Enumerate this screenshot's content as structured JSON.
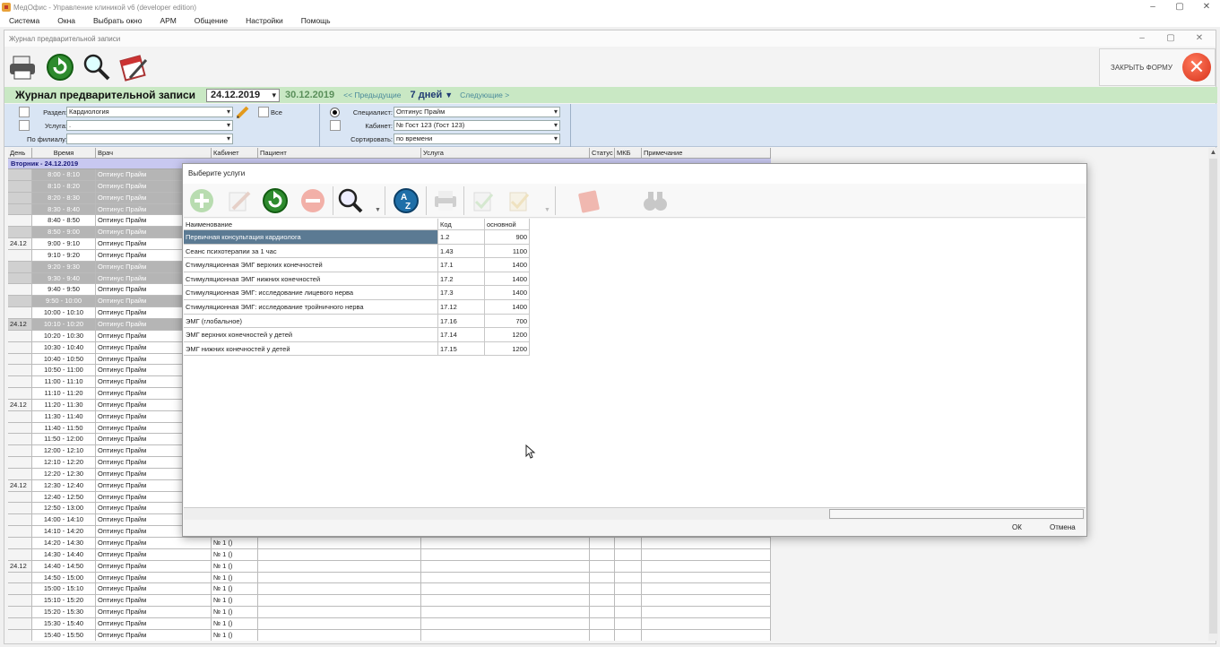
{
  "app": {
    "title": "МедОфис - Управление клиникой v6 (developer edition)"
  },
  "menu": [
    "Система",
    "Окна",
    "Выбрать окно",
    "АРМ",
    "Общение",
    "Настройки",
    "Помощь"
  ],
  "child_window": {
    "title": "Журнал предварительной записи"
  },
  "toolbar": {
    "close_form_label": "ЗАКРЫТЬ ФОРМУ"
  },
  "journal": {
    "title": "Журнал предварительной записи",
    "date_from": "24.12.2019",
    "date_to": "30.12.2019",
    "prev": "<< Предыдущие",
    "days": "7 дней",
    "next": "Следующие >"
  },
  "filters": {
    "section_label": "Раздел:",
    "section_value": "Кардиология",
    "service_label": "Услуга:",
    "service_value": ".",
    "branch_label": "По филиалу:",
    "branch_value": "",
    "all_label": "Все",
    "specialist_label": "Специалист:",
    "specialist_value": "Оптинус Прайм",
    "cabinet_label": "Кабинет:",
    "cabinet_value": "№ Гост 123 (Гост 123)",
    "sort_label": "Сортировать:",
    "sort_value": "по времени"
  },
  "grid": {
    "columns": [
      "День",
      "Время",
      "Врач",
      "Кабинет",
      "Пациент",
      "Услуга",
      "Статус",
      "МКБ",
      "Примечание"
    ],
    "day_header": "Вторник - 24.12.2019",
    "rows": [
      {
        "day": "",
        "time": "8:00 - 8:10",
        "doctor": "Оптинус Прайм",
        "cab": "",
        "busy": true
      },
      {
        "day": "",
        "time": "8:10 - 8:20",
        "doctor": "Оптинус Прайм",
        "cab": "",
        "busy": true
      },
      {
        "day": "",
        "time": "8:20 - 8:30",
        "doctor": "Оптинус Прайм",
        "cab": "",
        "busy": true
      },
      {
        "day": "",
        "time": "8:30 - 8:40",
        "doctor": "Оптинус Прайм",
        "cab": "",
        "busy": true
      },
      {
        "day": "",
        "time": "8:40 - 8:50",
        "doctor": "Оптинус Прайм",
        "cab": "",
        "busy": false
      },
      {
        "day": "",
        "time": "8:50 - 9:00",
        "doctor": "Оптинус Прайм",
        "cab": "",
        "busy": true
      },
      {
        "day": "24.12",
        "time": "9:00 - 9:10",
        "doctor": "Оптинус Прайм",
        "cab": "",
        "busy": false
      },
      {
        "day": "",
        "time": "9:10 - 9:20",
        "doctor": "Оптинус Прайм",
        "cab": "",
        "busy": false
      },
      {
        "day": "",
        "time": "9:20 - 9:30",
        "doctor": "Оптинус Прайм",
        "cab": "",
        "busy": true
      },
      {
        "day": "",
        "time": "9:30 - 9:40",
        "doctor": "Оптинус Прайм",
        "cab": "",
        "busy": true
      },
      {
        "day": "",
        "time": "9:40 - 9:50",
        "doctor": "Оптинус Прайм",
        "cab": "",
        "busy": false
      },
      {
        "day": "",
        "time": "9:50 - 10:00",
        "doctor": "Оптинус Прайм",
        "cab": "",
        "busy": true
      },
      {
        "day": "",
        "time": "10:00 - 10:10",
        "doctor": "Оптинус Прайм",
        "cab": "",
        "busy": false
      },
      {
        "day": "24.12",
        "time": "10:10 - 10:20",
        "doctor": "Оптинус Прайм",
        "cab": "",
        "busy": true
      },
      {
        "day": "",
        "time": "10:20 - 10:30",
        "doctor": "Оптинус Прайм",
        "cab": "",
        "busy": false
      },
      {
        "day": "",
        "time": "10:30 - 10:40",
        "doctor": "Оптинус Прайм",
        "cab": "",
        "busy": false
      },
      {
        "day": "",
        "time": "10:40 - 10:50",
        "doctor": "Оптинус Прайм",
        "cab": "",
        "busy": false
      },
      {
        "day": "",
        "time": "10:50 - 11:00",
        "doctor": "Оптинус Прайм",
        "cab": "",
        "busy": false
      },
      {
        "day": "",
        "time": "11:00 - 11:10",
        "doctor": "Оптинус Прайм",
        "cab": "",
        "busy": false
      },
      {
        "day": "",
        "time": "11:10 - 11:20",
        "doctor": "Оптинус Прайм",
        "cab": "",
        "busy": false
      },
      {
        "day": "24.12",
        "time": "11:20 - 11:30",
        "doctor": "Оптинус Прайм",
        "cab": "",
        "busy": false
      },
      {
        "day": "",
        "time": "11:30 - 11:40",
        "doctor": "Оптинус Прайм",
        "cab": "",
        "busy": false
      },
      {
        "day": "",
        "time": "11:40 - 11:50",
        "doctor": "Оптинус Прайм",
        "cab": "",
        "busy": false
      },
      {
        "day": "",
        "time": "11:50 - 12:00",
        "doctor": "Оптинус Прайм",
        "cab": "",
        "busy": false
      },
      {
        "day": "",
        "time": "12:00 - 12:10",
        "doctor": "Оптинус Прайм",
        "cab": "",
        "busy": false
      },
      {
        "day": "",
        "time": "12:10 - 12:20",
        "doctor": "Оптинус Прайм",
        "cab": "",
        "busy": false
      },
      {
        "day": "",
        "time": "12:20 - 12:30",
        "doctor": "Оптинус Прайм",
        "cab": "",
        "busy": false
      },
      {
        "day": "24.12",
        "time": "12:30 - 12:40",
        "doctor": "Оптинус Прайм",
        "cab": "",
        "busy": false
      },
      {
        "day": "",
        "time": "12:40 - 12:50",
        "doctor": "Оптинус Прайм",
        "cab": "",
        "busy": false
      },
      {
        "day": "",
        "time": "12:50 - 13:00",
        "doctor": "Оптинус Прайм",
        "cab": "",
        "busy": false
      },
      {
        "day": "",
        "time": "14:00 - 14:10",
        "doctor": "Оптинус Прайм",
        "cab": "",
        "busy": false
      },
      {
        "day": "",
        "time": "14:10 - 14:20",
        "doctor": "Оптинус Прайм",
        "cab": "",
        "busy": false
      },
      {
        "day": "",
        "time": "14:20 - 14:30",
        "doctor": "Оптинус Прайм",
        "cab": "№ 1 ()",
        "busy": false
      },
      {
        "day": "",
        "time": "14:30 - 14:40",
        "doctor": "Оптинус Прайм",
        "cab": "№ 1 ()",
        "busy": false
      },
      {
        "day": "24.12",
        "time": "14:40 - 14:50",
        "doctor": "Оптинус Прайм",
        "cab": "№ 1 ()",
        "busy": false
      },
      {
        "day": "",
        "time": "14:50 - 15:00",
        "doctor": "Оптинус Прайм",
        "cab": "№ 1 ()",
        "busy": false
      },
      {
        "day": "",
        "time": "15:00 - 15:10",
        "doctor": "Оптинус Прайм",
        "cab": "№ 1 ()",
        "busy": false
      },
      {
        "day": "",
        "time": "15:10 - 15:20",
        "doctor": "Оптинус Прайм",
        "cab": "№ 1 ()",
        "busy": false
      },
      {
        "day": "",
        "time": "15:20 - 15:30",
        "doctor": "Оптинус Прайм",
        "cab": "№ 1 ()",
        "busy": false
      },
      {
        "day": "",
        "time": "15:30 - 15:40",
        "doctor": "Оптинус Прайм",
        "cab": "№ 1 ()",
        "busy": false
      },
      {
        "day": "",
        "time": "15:40 - 15:50",
        "doctor": "Оптинус Прайм",
        "cab": "№ 1 ()",
        "busy": false
      }
    ]
  },
  "dialog": {
    "title": "Выберите услуги",
    "columns": [
      "Наименование",
      "Код",
      "основной"
    ],
    "rows": [
      {
        "name": "Первичная консультация кардиолога",
        "code": "1.2",
        "price": "900",
        "selected": true
      },
      {
        "name": "Сеанс психотерапии за 1 час",
        "code": "1.43",
        "price": "1100",
        "selected": false
      },
      {
        "name": "Стимуляционная ЭМГ верхних конечностей",
        "code": "17.1",
        "price": "1400",
        "selected": false
      },
      {
        "name": "Стимуляционная ЭМГ нижних конечностей",
        "code": "17.2",
        "price": "1400",
        "selected": false
      },
      {
        "name": "Стимуляционная ЭМГ: исследование лицевого нерва",
        "code": "17.3",
        "price": "1400",
        "selected": false
      },
      {
        "name": "Стимуляционная ЭМГ: исследование тройничного нерва",
        "code": "17.12",
        "price": "1400",
        "selected": false
      },
      {
        "name": "ЭМГ (глобальное)",
        "code": "17.16",
        "price": "700",
        "selected": false
      },
      {
        "name": "ЭМГ верхних конечностей у детей",
        "code": "17.14",
        "price": "1200",
        "selected": false
      },
      {
        "name": "ЭМГ нижних конечностей у детей",
        "code": "17.15",
        "price": "1200",
        "selected": false
      }
    ],
    "ok_label": "ОК",
    "cancel_label": "Отмена"
  }
}
